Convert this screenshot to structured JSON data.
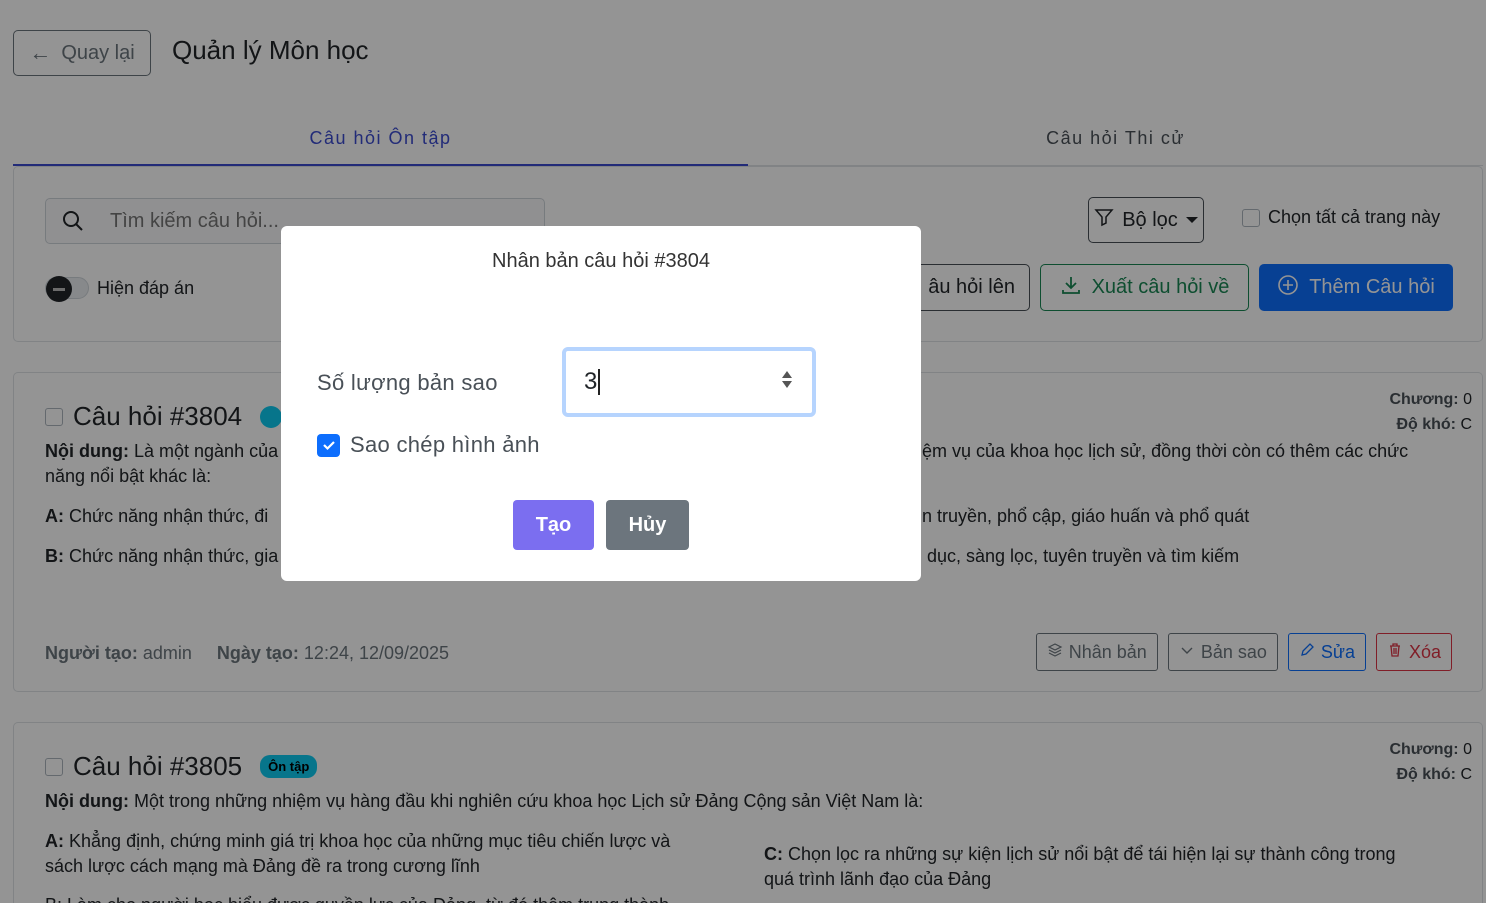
{
  "header": {
    "back_label": "Quay lại",
    "title": "Quản lý Môn học"
  },
  "tabs": [
    {
      "label": "Câu hỏi Ôn tập",
      "active": true
    },
    {
      "label": "Câu hỏi Thi cử",
      "active": false
    }
  ],
  "toolbar": {
    "search_placeholder": "Tìm kiếm câu hỏi...",
    "show_answers_label": "Hiện đáp án",
    "filter_label": "Bộ lọc",
    "select_all_label": "Chọn tất cả trang này",
    "import_label": "âu hỏi lên",
    "export_label": "Xuất câu hỏi về",
    "add_label": "Thêm Câu hỏi"
  },
  "questions": [
    {
      "title": "Câu hỏi #3804",
      "chapter_label": "Chương:",
      "chapter": "0",
      "difficulty_label": "Độ khó:",
      "difficulty": "C",
      "content_label": "Nội dung:",
      "content_left": "Là một ngành của",
      "content_right": "ệm vụ của khoa học lịch sử, đồng thời còn có thêm các chức",
      "content_line2": "năng nổi bật khác là:",
      "a_label": "A:",
      "a_left": "Chức năng nhận thức, đi",
      "a_right": "n truyền, phổ cập, giáo huấn và phổ quát",
      "b_label": "B:",
      "b_left": "Chức năng nhận thức, gia",
      "b_right": "dục, sàng lọc, tuyên truyền và tìm kiếm",
      "creator_label": "Người tạo:",
      "creator": "admin",
      "created_label": "Ngày tạo:",
      "created": "12:24, 12/09/2025",
      "actions": {
        "duplicate": "Nhân bản",
        "copy": "Bản sao",
        "edit": "Sửa",
        "delete": "Xóa"
      }
    },
    {
      "title": "Câu hỏi #3805",
      "badge": "Ôn tập",
      "chapter_label": "Chương:",
      "chapter": "0",
      "difficulty_label": "Độ khó:",
      "difficulty": "C",
      "content_label": "Nội dung:",
      "content": "Một trong những nhiệm vụ hàng đầu khi nghiên cứu khoa học Lịch sử Đảng Cộng sản Việt Nam là:",
      "a_label": "A:",
      "a_line1": "Khẳng định, chứng minh giá trị khoa học của những mục tiêu chiến lược và",
      "a_line2": "sách lược cách mạng mà Đảng đề ra trong cương lĩnh",
      "c_label": "C:",
      "c_line1": "Chọn lọc ra những sự kiện lịch sử nổi bật để tái hiện lại sự thành công trong",
      "c_line2": "quá trình lãnh đạo của Đảng",
      "b_partial": "B: Làm cho người học hiểu được quyền lực của Đảng, từ đó thêm trung thành"
    }
  ],
  "modal": {
    "title": "Nhân bản câu hỏi #3804",
    "quantity_label": "Số lượng bản sao",
    "quantity_value": "3",
    "copy_images_label": "Sao chép hình ảnh",
    "copy_images_checked": true,
    "create_label": "Tạo",
    "cancel_label": "Hủy"
  },
  "colors": {
    "primary": "#0d6efd",
    "tab_active": "#3b4bcf",
    "success": "#198754",
    "danger": "#dc3545",
    "create_button": "#7b6ef0",
    "cancel_button": "#6c757d"
  }
}
